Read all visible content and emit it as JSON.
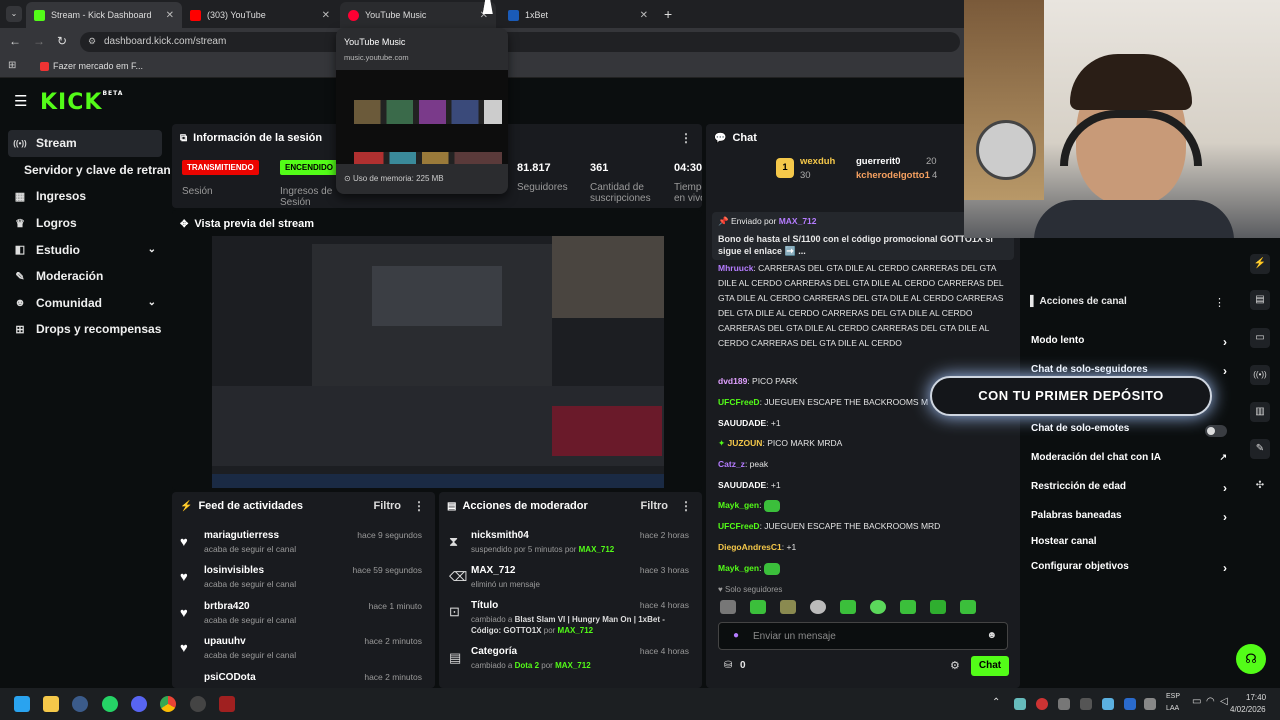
{
  "browser": {
    "tabs": [
      {
        "label": "Stream - Kick Dashboard",
        "color": "#53fc18",
        "active": true
      },
      {
        "label": "(303) YouTube",
        "color": "#ff0000",
        "active": false
      },
      {
        "label": "YouTube Music",
        "color": "#ff0033",
        "active": false
      },
      {
        "label": "1xBet",
        "color": "#1a5bb8",
        "active": false
      }
    ],
    "url": "dashboard.kick.com/stream",
    "bookmark": "Fazer mercado em F...",
    "tooltip": {
      "title": "YouTube Music",
      "domain": "music.youtube.com",
      "memory": "Uso de memoria: 225 MB"
    }
  },
  "kick": {
    "logo": "KICK",
    "logo_sup": "BETA",
    "sidebar": [
      {
        "label": "Stream",
        "icon": "broadcast-icon",
        "glyph": "((•))"
      },
      {
        "label": "Servidor y clave de retransmisión",
        "icon": "",
        "glyph": ""
      },
      {
        "label": "Ingresos",
        "icon": "chart-icon",
        "glyph": "▦"
      },
      {
        "label": "Logros",
        "icon": "trophy-icon",
        "glyph": "▮"
      },
      {
        "label": "Estudio",
        "icon": "studio-icon",
        "glyph": "◧"
      },
      {
        "label": "Moderación",
        "icon": "wrench-icon",
        "glyph": "✎"
      },
      {
        "label": "Comunidad",
        "icon": "people-icon",
        "glyph": "👥"
      },
      {
        "label": "Drops y recompensas",
        "icon": "gift-icon",
        "glyph": "⊞"
      }
    ],
    "session": {
      "title": "Información de la sesión",
      "live_badge": "TRANSMITIENDO",
      "on_badge": "ENCENDIDO",
      "session_label": "Sesión",
      "income_label": "Ingresos de Sesión",
      "followers_value": "81.817",
      "followers_label": "Seguidores",
      "subs_value": "361",
      "subs_label": "Cantidad de suscripciones",
      "time_value": "04:30:",
      "time_label": "Tiempo en vivo"
    },
    "preview_title": "Vista previa del stream",
    "feed": {
      "title": "Feed de actividades",
      "filter": "Filtro",
      "items": [
        {
          "name": "mariagutierress",
          "sub": "acaba de seguir el canal",
          "time": "hace 9 segundos"
        },
        {
          "name": "losinvisibles",
          "sub": "acaba de seguir el canal",
          "time": "hace 59 segundos"
        },
        {
          "name": "brtbra420",
          "sub": "acaba de seguir el canal",
          "time": "hace 1 minuto"
        },
        {
          "name": "upauuhv",
          "sub": "acaba de seguir el canal",
          "time": "hace 2 minutos"
        },
        {
          "name": "psiCODota",
          "sub": "",
          "time": "hace 2 minutos"
        }
      ]
    },
    "mod": {
      "title": "Acciones de moderador",
      "filter": "Filtro",
      "items": [
        {
          "name": "nicksmith04",
          "sub": "suspendido por 5 minutos por",
          "by": "MAX_712",
          "time": "hace 2 horas",
          "icon": "hourglass-icon",
          "glyph": "⧗"
        },
        {
          "name": "MAX_712",
          "sub": "eliminó un mensaje",
          "by": "",
          "time": "hace 3 horas",
          "icon": "trash-icon",
          "glyph": "🗑"
        },
        {
          "name": "Título",
          "sub": "cambiado a",
          "extra": "Blast Slam VI | Hungry Man On | 1xBet - Código: GOTTO1X",
          "by": "MAX_712",
          "time": "hace 4 horas",
          "icon": "title-icon",
          "glyph": "⊡"
        },
        {
          "name": "Categoría",
          "sub": "cambiado a",
          "extra": "Dota 2",
          "by": "MAX_712",
          "time": "hace 4 horas",
          "icon": "category-icon",
          "glyph": "▤"
        }
      ]
    },
    "chat": {
      "title": "Chat",
      "leaderboard": [
        {
          "name": "wexduh",
          "value": "30"
        },
        {
          "name": "guerrerit0",
          "value": "20"
        },
        {
          "name": "kcherodelgotto1",
          "value": "4"
        }
      ],
      "pinned_by_label": "Enviado por",
      "pinned_by": "MAX_712",
      "pinned_text": "Bono de hasta el S/1100 con el código promocional GOTTO1X si sigue el enlace ➡️ ...",
      "spam_user": "Mhruuck",
      "spam_text": "CARRERAS DEL GTA DILE AL CERDO CARRERAS DEL GTA DILE AL CERDO CARRERAS DEL GTA DILE AL CERDO CARRERAS DEL GTA DILE AL CERDO CARRERAS DEL GTA DILE AL CERDO CARRERAS DEL GTA DILE AL CERDO CARRERAS DEL GTA DILE AL CERDO CARRERAS DEL GTA DILE AL CERDO CARRERAS DEL GTA DILE AL CERDO CARRERAS DEL GTA DILE AL CERDO",
      "messages": [
        {
          "user": "dvd189",
          "text": "PICO PARK",
          "color": "#e0a0ff"
        },
        {
          "user": "UFCFreeD",
          "text": "JUEGUEN ESCAPE THE BACKROOMS M",
          "color": "#53fc18"
        },
        {
          "user": "SAUUDADE",
          "text": "+1",
          "color": "#ffffff"
        },
        {
          "user": "JUZOUN",
          "text": "PICO MARK MRDA",
          "color": "#f5c84a"
        },
        {
          "user": "Catz_z",
          "text": "peak",
          "color": "#b57cff"
        },
        {
          "user": "SAUUDADE",
          "text": "+1",
          "color": "#ffffff"
        },
        {
          "user": "Mayk_gen",
          "text": "",
          "color": "#53fc18"
        },
        {
          "user": "UFCFreeD",
          "text": "JUEGUEN ESCAPE THE BACKROOMS MRD",
          "color": "#53fc18"
        },
        {
          "user": "DiegoAndresC1",
          "text": "+1",
          "color": "#f5c84a"
        },
        {
          "user": "Mayk_gen",
          "text": "",
          "color": "#53fc18"
        }
      ],
      "followers_only": "Solo seguidores",
      "input_placeholder": "Enviar un mensaje",
      "points": "0",
      "send": "Chat"
    },
    "channel_actions": {
      "title": "Acciones de canal",
      "banner": "CON TU PRIMER DEPÓSITO",
      "items": [
        {
          "label": "Modo lento",
          "kind": "chevron"
        },
        {
          "label": "Chat de solo-seguidores",
          "kind": "chevron"
        },
        {
          "label": "Chat de solo-emotes",
          "kind": "toggle"
        },
        {
          "label": "Moderación del chat con IA",
          "kind": "link"
        },
        {
          "label": "Restricción de edad",
          "kind": "chevron"
        },
        {
          "label": "Palabras baneadas",
          "kind": "chevron"
        },
        {
          "label": "Hostear canal",
          "kind": "none"
        },
        {
          "label": "Configurar objetivos",
          "kind": "chevron"
        }
      ]
    }
  },
  "taskbar": {
    "lang": "ESP",
    "layout": "LAA",
    "time": "17:40",
    "date": "4/02/2026"
  },
  "colors": {
    "accent": "#53fc18",
    "live": "#eb0400",
    "panel": "#191b1f"
  }
}
